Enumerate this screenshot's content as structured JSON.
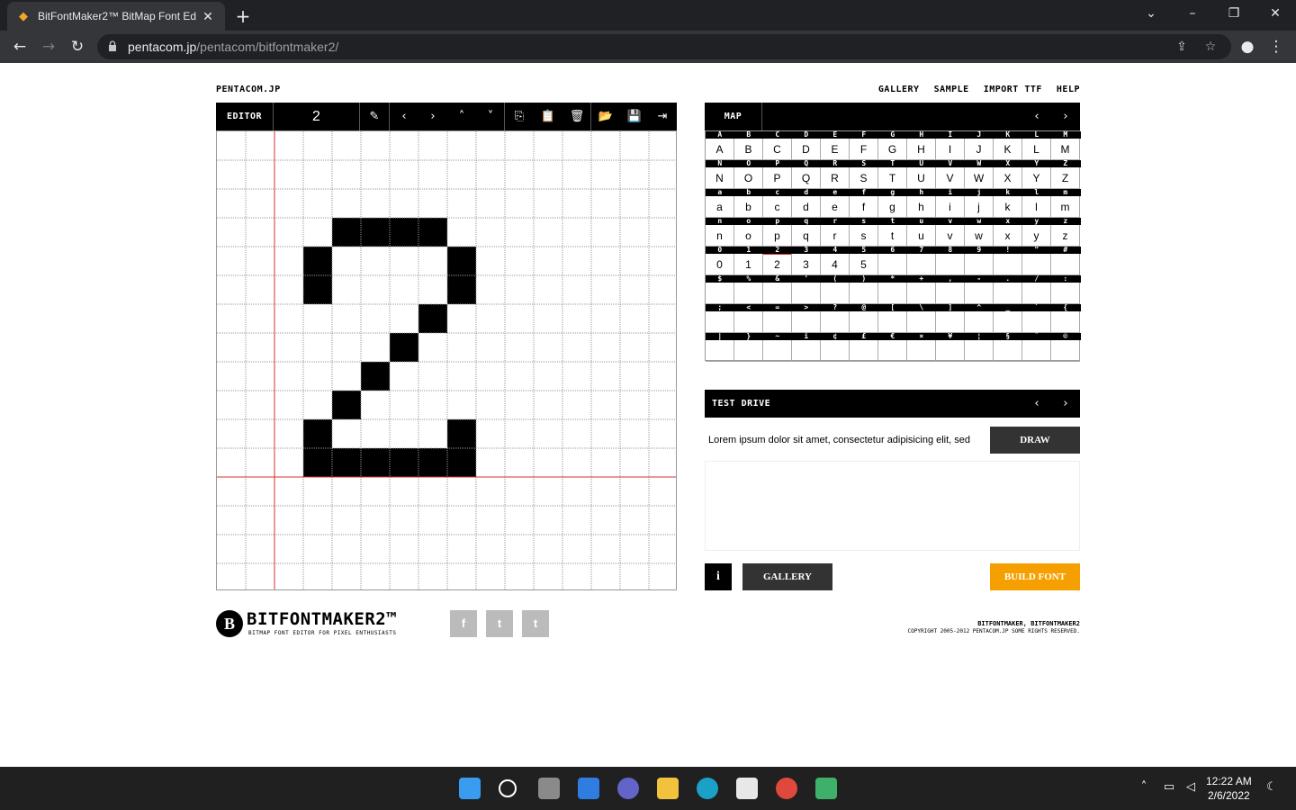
{
  "browser": {
    "tab_title": "BitFontMaker2™ BitMap Font Ed",
    "url_host": "pentacom.jp",
    "url_path": "/pentacom/bitfontmaker2/"
  },
  "header": {
    "site_link": "PENTACOM.JP",
    "nav": [
      "GALLERY",
      "SAMPLE",
      "IMPORT TTF",
      "HELP"
    ]
  },
  "editor": {
    "label": "EDITOR",
    "glyph": "2",
    "filled_cells": [
      [
        4,
        3
      ],
      [
        5,
        3
      ],
      [
        6,
        3
      ],
      [
        7,
        3
      ],
      [
        3,
        4
      ],
      [
        8,
        4
      ],
      [
        3,
        5
      ],
      [
        8,
        5
      ],
      [
        7,
        6
      ],
      [
        6,
        7
      ],
      [
        5,
        8
      ],
      [
        4,
        9
      ],
      [
        3,
        10
      ],
      [
        8,
        10
      ],
      [
        3,
        11
      ],
      [
        4,
        11
      ],
      [
        5,
        11
      ],
      [
        6,
        11
      ],
      [
        7,
        11
      ],
      [
        8,
        11
      ]
    ]
  },
  "map": {
    "label": "MAP",
    "rows": [
      {
        "hdr": [
          "A",
          "B",
          "C",
          "D",
          "E",
          "F",
          "G",
          "H",
          "I",
          "J",
          "K",
          "L",
          "M"
        ],
        "cells": [
          "A",
          "B",
          "C",
          "D",
          "E",
          "F",
          "G",
          "H",
          "I",
          "J",
          "K",
          "L",
          "M"
        ]
      },
      {
        "hdr": [
          "N",
          "O",
          "P",
          "Q",
          "R",
          "S",
          "T",
          "U",
          "V",
          "W",
          "X",
          "Y",
          "Z"
        ],
        "cells": [
          "N",
          "O",
          "P",
          "Q",
          "R",
          "S",
          "T",
          "U",
          "V",
          "W",
          "X",
          "Y",
          "Z"
        ]
      },
      {
        "hdr": [
          "a",
          "b",
          "c",
          "d",
          "e",
          "f",
          "g",
          "h",
          "i",
          "j",
          "k",
          "l",
          "m"
        ],
        "cells": [
          "a",
          "b",
          "c",
          "d",
          "e",
          "f",
          "g",
          "h",
          "i",
          "j",
          "k",
          "l",
          "m"
        ]
      },
      {
        "hdr": [
          "n",
          "o",
          "p",
          "q",
          "r",
          "s",
          "t",
          "u",
          "v",
          "w",
          "x",
          "y",
          "z"
        ],
        "cells": [
          "n",
          "o",
          "p",
          "q",
          "r",
          "s",
          "t",
          "u",
          "v",
          "w",
          "x",
          "y",
          "z"
        ]
      },
      {
        "hdr": [
          "0",
          "1",
          "2",
          "3",
          "4",
          "5",
          "6",
          "7",
          "8",
          "9",
          "!",
          "\"",
          "#"
        ],
        "cells": [
          "0",
          "1",
          "2",
          "3",
          "4",
          "5",
          "",
          "",
          "",
          "",
          "",
          "",
          ""
        ]
      },
      {
        "hdr": [
          "$",
          "%",
          "&",
          "'",
          "(",
          ")",
          "*",
          "+",
          ",",
          "-",
          ".",
          "/",
          ":"
        ],
        "cells": [
          "",
          "",
          "",
          "",
          "",
          "",
          "",
          "",
          "",
          "",
          "",
          "",
          ""
        ]
      },
      {
        "hdr": [
          ";",
          "<",
          "=",
          ">",
          "?",
          "@",
          "[",
          "\\",
          "]",
          "^",
          "_",
          "`",
          "{"
        ],
        "cells": [
          "",
          "",
          "",
          "",
          "",
          "",
          "",
          "",
          "",
          "",
          "",
          "",
          ""
        ]
      },
      {
        "hdr": [
          "|",
          "}",
          "~",
          "i",
          "¢",
          "£",
          "€",
          "×",
          "¥",
          "¦",
          "§",
          "¨",
          "©"
        ],
        "cells": [
          "",
          "",
          "",
          "",
          "",
          "",
          "",
          "",
          "",
          "",
          "",
          "",
          ""
        ]
      }
    ]
  },
  "test_drive": {
    "label": "TEST DRIVE",
    "text": "Lorem ipsum dolor sit amet, consectetur adipisicing elit, sed",
    "draw_button": "DRAW"
  },
  "actions": {
    "info": "i",
    "gallery": "GALLERY",
    "build": "BUILD FONT"
  },
  "footer": {
    "logo_letter": "B",
    "logo_text": "BITFONTMAKER2™",
    "logo_sub": "BITMAP FONT EDITOR FOR PIXEL ENTHUSIASTS",
    "social": [
      "f",
      "t",
      "t"
    ],
    "copyright_line1": "BITFONTMAKER, BITFONTMAKER2",
    "copyright_line2": "COPYRIGHT 2005-2012 PENTACOM.JP SOME RIGHTS RESERVED."
  },
  "taskbar": {
    "time": "12:22 AM",
    "date": "2/6/2022"
  },
  "colors": {
    "accent": "#f5a000",
    "guide_line": "#d33333"
  }
}
